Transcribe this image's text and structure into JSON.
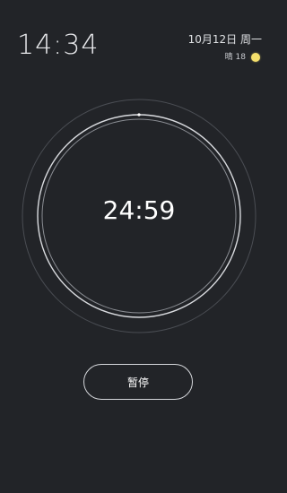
{
  "status": {
    "time": "14:34",
    "date": "10月12日 周一",
    "weather_text": "晴 18",
    "weather_icon": "sun-icon"
  },
  "timer": {
    "remaining": "24:59",
    "progress_fraction": 0.0007
  },
  "controls": {
    "pause_label": "暂停"
  },
  "colors": {
    "background": "#222428",
    "ring": "#d9dbdf",
    "outer_ring": "#4a4d53",
    "sun": "#f4df6c"
  }
}
